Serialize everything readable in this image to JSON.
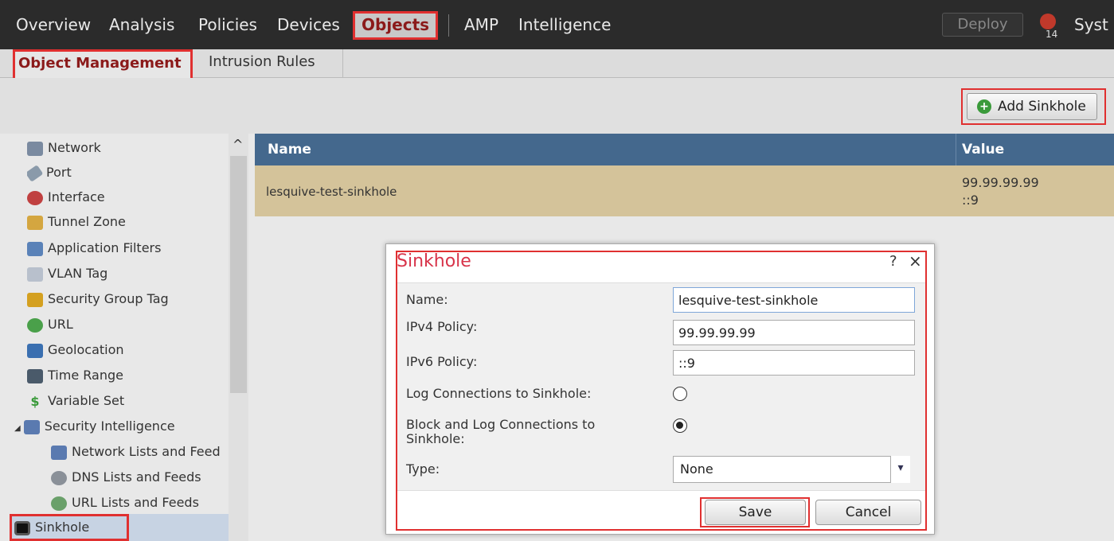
{
  "topnav": {
    "items": [
      "Overview",
      "Analysis",
      "Policies",
      "Devices",
      "Objects",
      "AMP",
      "Intelligence"
    ],
    "deploy_label": "Deploy",
    "alert_count": "14",
    "system_label": "Syst"
  },
  "subnav": {
    "items": [
      "Object Management",
      "Intrusion Rules"
    ]
  },
  "toolbar": {
    "add_label": "Add Sinkhole"
  },
  "sidebar": {
    "items": [
      "Network",
      "Port",
      "Interface",
      "Tunnel Zone",
      "Application Filters",
      "VLAN Tag",
      "Security Group Tag",
      "URL",
      "Geolocation",
      "Time Range",
      "Variable Set",
      "Security Intelligence",
      "Network Lists and Feed",
      "DNS Lists and Feeds",
      "URL Lists and Feeds",
      "Sinkhole"
    ]
  },
  "table": {
    "columns": [
      "Name",
      "Value"
    ],
    "rows": [
      {
        "name": "lesquive-test-sinkhole",
        "value_ipv4": "99.99.99.99",
        "value_ipv6": "::9"
      }
    ]
  },
  "dialog": {
    "title": "Sinkhole",
    "help": "?",
    "close": "×",
    "name_label": "Name:",
    "name_value": "lesquive-test-sinkhole",
    "ipv4_label": "IPv4 Policy:",
    "ipv4_value": "99.99.99.99",
    "ipv6_label": "IPv6 Policy:",
    "ipv6_value": "::9",
    "log_label": "Log Connections to Sinkhole:",
    "block_label_1": "Block and Log Connections to",
    "block_label_2": "Sinkhole:",
    "type_label": "Type:",
    "type_value": "None",
    "save_label": "Save",
    "cancel_label": "Cancel"
  },
  "colors": {
    "accent_red": "#e03030",
    "table_header": "#44688d",
    "row_highlight": "#d4c39a",
    "dialog_title": "#d8344a"
  }
}
